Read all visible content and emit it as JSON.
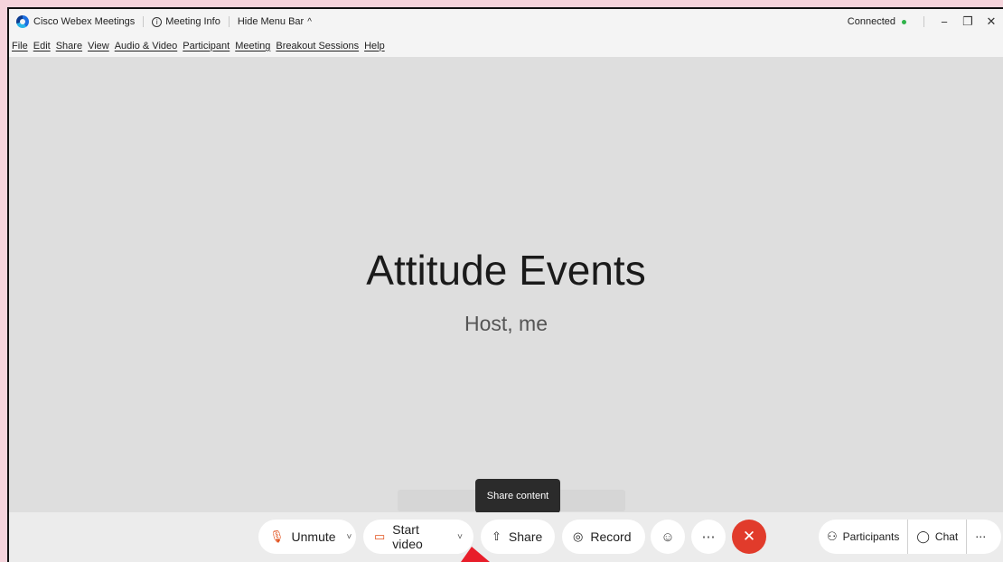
{
  "titlebar": {
    "app_name": "Cisco Webex Meetings",
    "meeting_info": "Meeting Info",
    "hide_menu": "Hide Menu Bar",
    "status": "Connected"
  },
  "menu": [
    "File",
    "Edit",
    "Share",
    "View",
    "Audio & Video",
    "Participant",
    "Meeting",
    "Breakout Sessions",
    "Help"
  ],
  "stage": {
    "title": "Attitude Events",
    "subtitle": "Host, me"
  },
  "tooltip": "Share content",
  "controls": {
    "unmute": "Unmute",
    "start_video": "Start video",
    "share": "Share",
    "record": "Record",
    "participants": "Participants",
    "chat": "Chat"
  },
  "colors": {
    "end_call": "#e13b2b",
    "muted_icon": "#e2531f",
    "connected_dot": "#2fb34a"
  }
}
